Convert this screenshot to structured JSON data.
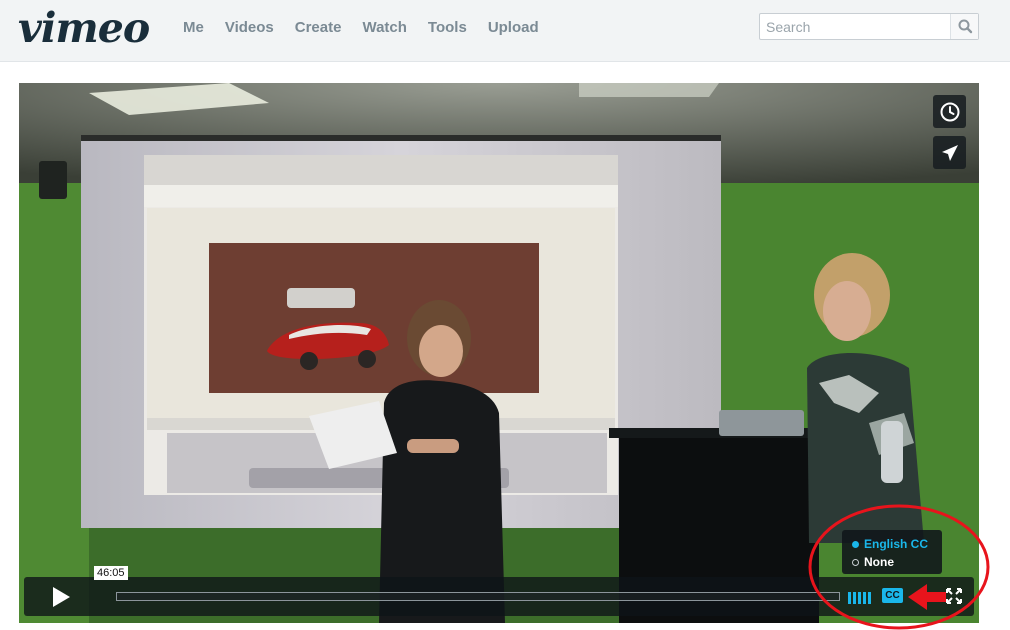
{
  "brand": {
    "logo_text": "vimeo"
  },
  "nav": {
    "items": [
      {
        "label": "Me"
      },
      {
        "label": "Videos"
      },
      {
        "label": "Create"
      },
      {
        "label": "Watch"
      },
      {
        "label": "Tools"
      },
      {
        "label": "Upload"
      }
    ]
  },
  "search": {
    "placeholder": "Search",
    "value": ""
  },
  "player": {
    "current_time": "46:05",
    "progress": 0.0,
    "captions_menu": [
      {
        "label": "English CC",
        "selected": true
      },
      {
        "label": "None",
        "selected": false
      }
    ],
    "cc_button_label": "CC",
    "side_buttons": [
      "clock-icon",
      "paper-plane-icon"
    ]
  },
  "colors": {
    "accent": "#1ab7ea",
    "annotation": "#e8141c",
    "nav_text": "#7b8a94"
  }
}
